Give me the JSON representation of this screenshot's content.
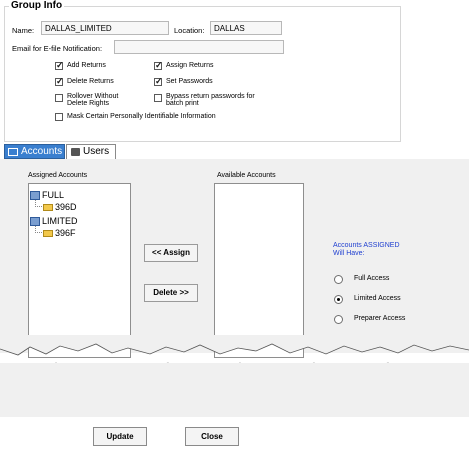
{
  "group_info": {
    "title": "Group Info",
    "name_label": "Name:",
    "name_value": "DALLAS_LIMITED",
    "location_label": "Location:",
    "location_value": "DALLAS",
    "email_label": "Email for E-file Notification:",
    "email_value": "",
    "checkboxes": [
      {
        "label": "Add Returns",
        "checked": true
      },
      {
        "label": "Assign Returns",
        "checked": true
      },
      {
        "label": "Delete Returns",
        "checked": true
      },
      {
        "label": "Set Passwords",
        "checked": true
      },
      {
        "label_line1": "Rollover Without",
        "label_line2": "Delete Rights",
        "checked": false
      },
      {
        "label_line1": "Bypass return passwords for",
        "label_line2": "batch print",
        "checked": false
      },
      {
        "label": "Mask Certain Personally Identifiable Information",
        "checked": false
      }
    ]
  },
  "tabs": [
    {
      "label": "Accounts",
      "active": true
    },
    {
      "label": "Users",
      "active": false
    }
  ],
  "assigned": {
    "header": "Assigned Accounts",
    "items": [
      {
        "label": "FULL",
        "child": "396D"
      },
      {
        "label": "LIMITED",
        "child": "396F"
      }
    ]
  },
  "available": {
    "header": "Available Accounts"
  },
  "buttons": {
    "assign": "<< Assign",
    "delete": "Delete >>",
    "update": "Update",
    "close": "Close"
  },
  "access": {
    "heading_line1": "Accounts ASSIGNED",
    "heading_line2": "Will Have:",
    "options": [
      {
        "label": "Full Access",
        "selected": false
      },
      {
        "label": "Limited Access",
        "selected": true
      },
      {
        "label": "Preparer Access",
        "selected": false
      }
    ]
  },
  "colors": {
    "tab_active": "#3a7fcf",
    "access_heading": "#1f3fd0"
  }
}
